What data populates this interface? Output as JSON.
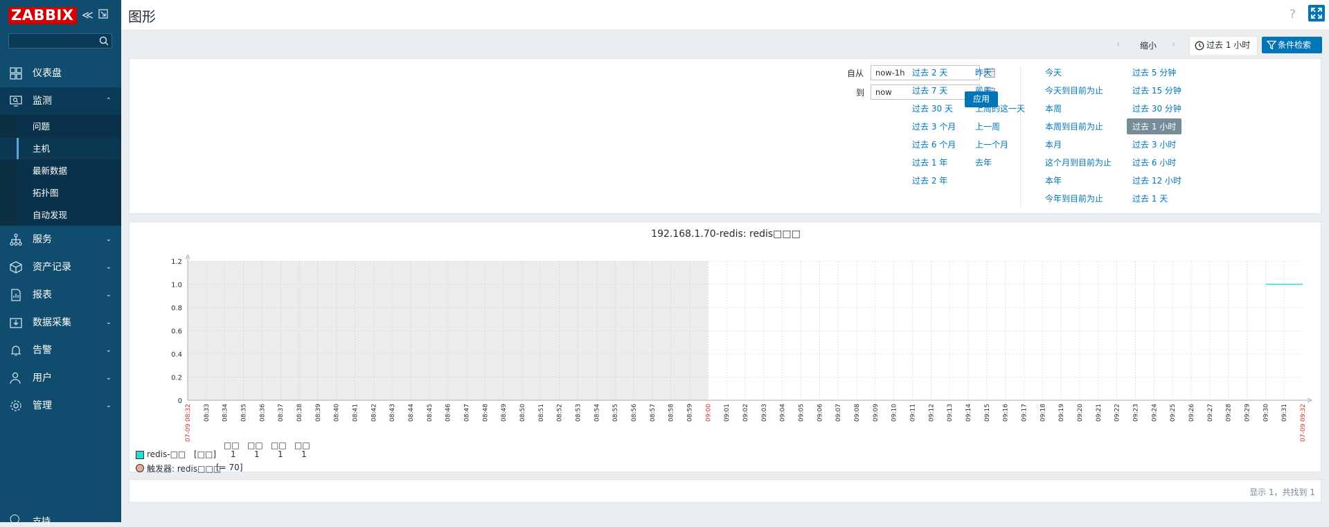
{
  "sidebar": {
    "logo": "ZABBIX",
    "nav": [
      {
        "label": "仪表盘",
        "icon": "dashboard-icon"
      },
      {
        "label": "监测",
        "icon": "monitoring-icon",
        "expanded": true,
        "children": [
          {
            "label": "问题"
          },
          {
            "label": "主机",
            "active": true
          },
          {
            "label": "最新数据"
          },
          {
            "label": "拓扑图"
          },
          {
            "label": "自动发现"
          }
        ]
      },
      {
        "label": "服务",
        "icon": "services-icon"
      },
      {
        "label": "资产记录",
        "icon": "inventory-icon"
      },
      {
        "label": "报表",
        "icon": "reports-icon"
      },
      {
        "label": "数据采集",
        "icon": "data-collection-icon"
      },
      {
        "label": "告警",
        "icon": "alerts-icon"
      },
      {
        "label": "用户",
        "icon": "users-icon"
      },
      {
        "label": "管理",
        "icon": "administration-icon"
      }
    ],
    "support": "支持"
  },
  "header": {
    "title": "图形",
    "help": "?"
  },
  "filter": {
    "zoom_out": "缩小",
    "range_tab": "过去 1 小时",
    "filter_button": "条件检索",
    "from_label": "自从",
    "from_value": "now-1h",
    "to_label": "到",
    "to_value": "now",
    "apply": "应用",
    "quick_ranges": [
      [
        "过去 2 天",
        "过去 7 天",
        "过去 30 天",
        "过去 3 个月",
        "过去 6 个月",
        "过去 1 年",
        "过去 2 年"
      ],
      [
        "昨天",
        "前天",
        "上周的这一天",
        "上一周",
        "上一个月",
        "去年"
      ],
      [
        "今天",
        "今天到目前为止",
        "本周",
        "本周到目前为止",
        "本月",
        "这个月到目前为止",
        "本年",
        "今年到目前为止"
      ],
      [
        "过去 5 分钟",
        "过去 15 分钟",
        "过去 30 分钟",
        "过去 1 小时",
        "过去 3 小时",
        "过去 6 小时",
        "过去 12 小时",
        "过去 1 天"
      ]
    ],
    "selected_quick": "过去 1 小时"
  },
  "graph": {
    "title": "192.168.1.70-redis: redis□□□",
    "colors": {
      "series": "#26dcd0",
      "nodata": "#ececec",
      "time_red": "#cc3333",
      "grid": "#cccccc"
    },
    "chart_data": {
      "type": "line",
      "ylim": [
        0,
        1.2
      ],
      "yticks": [
        "0",
        "0.2",
        "0.4",
        "0.6",
        "0.8",
        "1.0",
        "1.2"
      ],
      "x_start_label": "07-09 08:32",
      "x_end_label": "07-09 09:32",
      "x_mid_label": "09:00",
      "x_minutes": [
        "08:33",
        "08:34",
        "08:35",
        "08:36",
        "08:37",
        "08:38",
        "08:39",
        "08:40",
        "08:41",
        "08:42",
        "08:43",
        "08:44",
        "08:45",
        "08:46",
        "08:47",
        "08:48",
        "08:49",
        "08:50",
        "08:51",
        "08:52",
        "08:53",
        "08:54",
        "08:55",
        "08:56",
        "08:57",
        "08:58",
        "08:59",
        "09:00",
        "09:01",
        "09:02",
        "09:03",
        "09:04",
        "09:05",
        "09:06",
        "09:07",
        "09:08",
        "09:09",
        "09:10",
        "09:11",
        "09:12",
        "09:13",
        "09:14",
        "09:15",
        "09:16",
        "09:17",
        "09:18",
        "09:19",
        "09:20",
        "09:21",
        "09:22",
        "09:23",
        "09:24",
        "09:25",
        "09:26",
        "09:27",
        "09:28",
        "09:29",
        "09:30",
        "09:31"
      ],
      "nodata_until": "09:00",
      "series": [
        {
          "name": "redis-□□",
          "points": [
            {
              "x": "09:30",
              "y": 1
            },
            {
              "x": "09:32",
              "y": 1
            }
          ]
        }
      ],
      "grid": true
    },
    "legend": {
      "headers": [
        "□□",
        "□□",
        "□□",
        "□□"
      ],
      "series_label": "redis-□□",
      "series_func": "[□□]",
      "values": [
        "1",
        "1",
        "1",
        "1"
      ],
      "trigger_label": "触发器: redis□□□",
      "trigger_value": "[= 70]"
    }
  },
  "footer": {
    "text": "显示 1，共找到 1"
  }
}
